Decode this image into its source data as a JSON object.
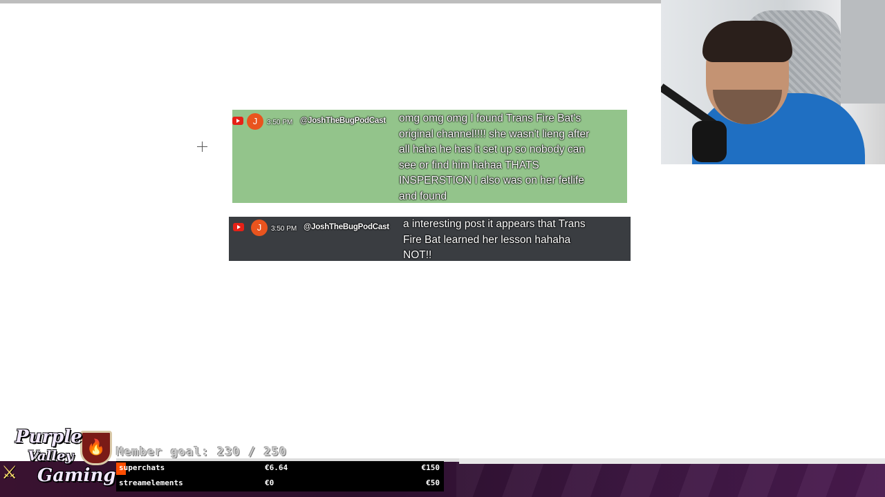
{
  "chat": [
    {
      "platform_icon": "youtube-icon",
      "avatar_initial": "J",
      "time": "3:50 PM",
      "author": "@JoshTheBugPodCast",
      "lines": [
        "omg omg omg I found Trans Fire Bat's",
        "original channel!!!! she wasn't lieng after",
        "all haha he has it set up so nobody can",
        "see or find him hahaa THATS",
        "INSPERSTION I also was on her fetlife",
        "and found"
      ],
      "bg_color": "#93c48b"
    },
    {
      "platform_icon": "youtube-icon",
      "avatar_initial": "J",
      "time": "3:50 PM",
      "author": "@JoshTheBugPodCast",
      "lines": [
        "a interesting post it appears that Trans",
        "Fire Bat learned her lesson hahaha",
        "NOT!!"
      ],
      "bg_color": "#3a3d41"
    }
  ],
  "overlay": {
    "logo_lines": [
      "Purple",
      "Valley",
      "Gaming"
    ],
    "member_goal": "Member goal: 230 / 250",
    "goals": [
      {
        "name": "superchats",
        "current": "€6.64",
        "target": "€150",
        "progress": 0.044
      },
      {
        "name": "streamelements",
        "current": "€0",
        "target": "€50",
        "progress": 0
      }
    ]
  },
  "colors": {
    "accent": "#ff4d00",
    "youtube": "#e62117",
    "avatar": "#e9541e",
    "overlay_bg": "#2b0f2b"
  }
}
